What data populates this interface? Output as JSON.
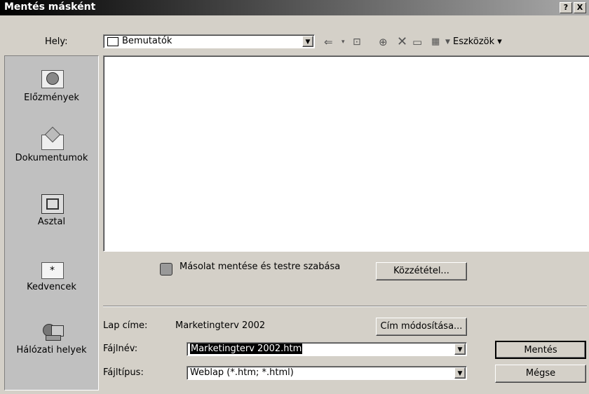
{
  "window": {
    "title": "Mentés másként",
    "help_btn": "?",
    "close_btn": "X"
  },
  "location": {
    "label": "Hely:",
    "value": "Bemutatók"
  },
  "toolbar": {
    "tools_label": "Eszközök"
  },
  "places": [
    {
      "label": "Előzmények",
      "icon": "history-icon"
    },
    {
      "label": "Dokumentumok",
      "icon": "documents-icon"
    },
    {
      "label": "Asztal",
      "icon": "desktop-icon"
    },
    {
      "label": "Kedvencek",
      "icon": "favorites-icon"
    },
    {
      "label": "Hálózati helyek",
      "icon": "network-icon"
    }
  ],
  "copy_option": {
    "label": "Másolat mentése és testre szabása",
    "publish_button": "Közzététel..."
  },
  "page_title": {
    "label": "Lap címe:",
    "value": "Marketingterv 2002",
    "change_button": "Cím módosítása..."
  },
  "filename": {
    "label": "Fájlnév:",
    "value": "Marketingterv 2002.htm"
  },
  "filetype": {
    "label": "Fájltípus:",
    "value": "Weblap (*.htm; *.html)"
  },
  "buttons": {
    "save": "Mentés",
    "cancel": "Mégse"
  }
}
